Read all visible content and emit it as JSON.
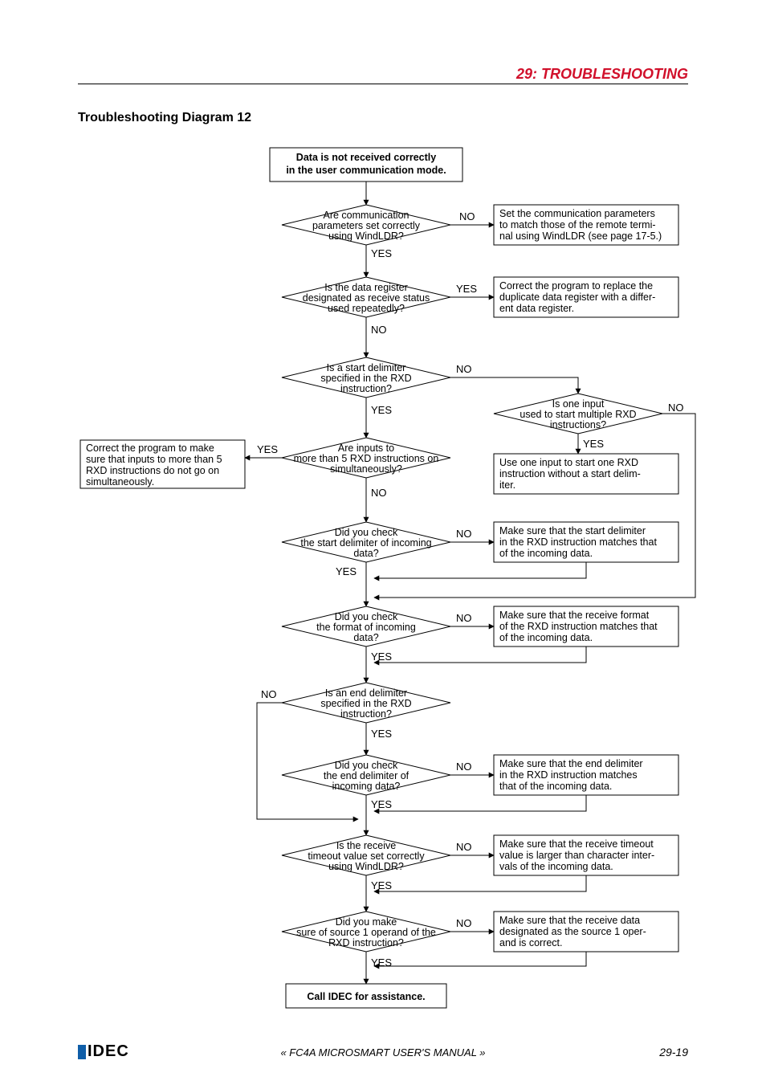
{
  "header": {
    "chapter": "29:",
    "title": "TROUBLESHOOTING"
  },
  "section_title": "Troubleshooting Diagram 12",
  "footer": {
    "manual": "« FC4A MICROSMART USER'S MANUAL »",
    "page": "29-19",
    "brand": "IDEC"
  },
  "labels": {
    "yes": "YES",
    "no": "NO"
  },
  "start": {
    "l1": "Data is not received correctly",
    "l2": "in the user communication mode."
  },
  "q1": {
    "l1": "Are communication",
    "l2": "parameters set correctly",
    "l3": "using WindLDR?"
  },
  "a1": {
    "l1": "Set the communication parameters",
    "l2": "to match those of the remote termi-",
    "l3": "nal using WindLDR (see page 17-5.)"
  },
  "q2": {
    "l1": "Is the data register",
    "l2": "designated as receive status",
    "l3": "used repeatedly?"
  },
  "a2": {
    "l1": "Correct the program to replace the",
    "l2": "duplicate data register with a differ-",
    "l3": "ent data register."
  },
  "q3": {
    "l1": "Is a start delimiter",
    "l2": "specified in the RXD",
    "l3": "instruction?"
  },
  "q3b": {
    "l1": "Is one input",
    "l2": "used to start multiple RXD",
    "l3": "instructions?"
  },
  "a3b": {
    "l1": "Use one input to start one RXD",
    "l2": "instruction without a start delim-",
    "l3": "iter."
  },
  "q4": {
    "l1": "Are inputs to",
    "l2": "more than 5 RXD instructions on",
    "l3": "simultaneously?"
  },
  "a4": {
    "l1": "Correct the program to make",
    "l2": "sure that inputs to more than 5",
    "l3": "RXD instructions do not go on",
    "l4": "simultaneously."
  },
  "q5": {
    "l1": "Did you check",
    "l2": "the start delimiter of incoming",
    "l3": "data?"
  },
  "a5": {
    "l1": "Make sure that the start delimiter",
    "l2": "in the RXD instruction matches that",
    "l3": "of the incoming data."
  },
  "q6": {
    "l1": "Did you check",
    "l2": "the format of incoming",
    "l3": "data?"
  },
  "a6": {
    "l1": "Make sure that the receive format",
    "l2": "of the RXD instruction matches that",
    "l3": "of the incoming data."
  },
  "q7": {
    "l1": "Is an end delimiter",
    "l2": "specified in the RXD",
    "l3": "instruction?"
  },
  "q8": {
    "l1": "Did you check",
    "l2": "the end delimiter of",
    "l3": "incoming data?"
  },
  "a8": {
    "l1": "Make sure that the end delimiter",
    "l2": "in the RXD instruction matches",
    "l3": "that of the incoming data."
  },
  "q9": {
    "l1": "Is the receive",
    "l2": "timeout value set correctly",
    "l3": "using WindLDR?"
  },
  "a9": {
    "l1": "Make sure that the receive timeout",
    "l2": "value is larger than character inter-",
    "l3": "vals of the incoming data."
  },
  "q10": {
    "l1": "Did you make",
    "l2": "sure of source 1 operand of the",
    "l3": "RXD instruction?"
  },
  "a10": {
    "l1": "Make sure that the receive data",
    "l2": "designated as the source 1 oper-",
    "l3": "and is correct."
  },
  "end": {
    "l1": "Call IDEC for assistance."
  },
  "chart_data": {
    "type": "flowchart",
    "title": "Troubleshooting Diagram 12",
    "nodes": [
      {
        "id": "start",
        "type": "terminator",
        "text": "Data is not received correctly in the user communication mode."
      },
      {
        "id": "q1",
        "type": "decision",
        "text": "Are communication parameters set correctly using WindLDR?"
      },
      {
        "id": "a1",
        "type": "process",
        "text": "Set the communication parameters to match those of the remote terminal using WindLDR (see page 17-5.)"
      },
      {
        "id": "q2",
        "type": "decision",
        "text": "Is the data register designated as receive status used repeatedly?"
      },
      {
        "id": "a2",
        "type": "process",
        "text": "Correct the program to replace the duplicate data register with a different data register."
      },
      {
        "id": "q3",
        "type": "decision",
        "text": "Is a start delimiter specified in the RXD instruction?"
      },
      {
        "id": "q3b",
        "type": "decision",
        "text": "Is one input used to start multiple RXD instructions?"
      },
      {
        "id": "a3b",
        "type": "process",
        "text": "Use one input to start one RXD instruction without a start delimiter."
      },
      {
        "id": "q4",
        "type": "decision",
        "text": "Are inputs to more than 5 RXD instructions on simultaneously?"
      },
      {
        "id": "a4",
        "type": "process",
        "text": "Correct the program to make sure that inputs to more than 5 RXD instructions do not go on simultaneously."
      },
      {
        "id": "q5",
        "type": "decision",
        "text": "Did you check the start delimiter of incoming data?"
      },
      {
        "id": "a5",
        "type": "process",
        "text": "Make sure that the start delimiter in the RXD instruction matches that of the incoming data."
      },
      {
        "id": "q6",
        "type": "decision",
        "text": "Did you check the format of incoming data?"
      },
      {
        "id": "a6",
        "type": "process",
        "text": "Make sure that the receive format of the RXD instruction matches that of the incoming data."
      },
      {
        "id": "q7",
        "type": "decision",
        "text": "Is an end delimiter specified in the RXD instruction?"
      },
      {
        "id": "q8",
        "type": "decision",
        "text": "Did you check the end delimiter of incoming data?"
      },
      {
        "id": "a8",
        "type": "process",
        "text": "Make sure that the end delimiter in the RXD instruction matches that of the incoming data."
      },
      {
        "id": "q9",
        "type": "decision",
        "text": "Is the receive timeout value set correctly using WindLDR?"
      },
      {
        "id": "a9",
        "type": "process",
        "text": "Make sure that the receive timeout value is larger than character intervals of the incoming data."
      },
      {
        "id": "q10",
        "type": "decision",
        "text": "Did you make sure of source 1 operand of the RXD instruction?"
      },
      {
        "id": "a10",
        "type": "process",
        "text": "Make sure that the receive data designated as the source 1 operand is correct."
      },
      {
        "id": "end",
        "type": "terminator",
        "text": "Call IDEC for assistance."
      }
    ],
    "edges": [
      {
        "from": "start",
        "to": "q1"
      },
      {
        "from": "q1",
        "to": "a1",
        "label": "NO"
      },
      {
        "from": "q1",
        "to": "q2",
        "label": "YES"
      },
      {
        "from": "q2",
        "to": "a2",
        "label": "YES"
      },
      {
        "from": "q2",
        "to": "q3",
        "label": "NO"
      },
      {
        "from": "q3",
        "to": "q3b",
        "label": "NO"
      },
      {
        "from": "q3",
        "to": "q4",
        "label": "YES"
      },
      {
        "from": "q3b",
        "to": "a3b",
        "label": "YES"
      },
      {
        "from": "q3b",
        "to": "q6",
        "label": "NO",
        "note": "rejoins main flow before q6"
      },
      {
        "from": "q4",
        "to": "a4",
        "label": "YES"
      },
      {
        "from": "q4",
        "to": "q5",
        "label": "NO"
      },
      {
        "from": "q5",
        "to": "a5",
        "label": "NO"
      },
      {
        "from": "a5",
        "to": "q5",
        "type": "feedback"
      },
      {
        "from": "q5",
        "to": "q6",
        "label": "YES"
      },
      {
        "from": "q6",
        "to": "a6",
        "label": "NO"
      },
      {
        "from": "a6",
        "to": "q6",
        "type": "feedback"
      },
      {
        "from": "q6",
        "to": "q7",
        "label": "YES"
      },
      {
        "from": "q7",
        "to": "q9",
        "label": "NO",
        "note": "skips end-delimiter check"
      },
      {
        "from": "q7",
        "to": "q8",
        "label": "YES"
      },
      {
        "from": "q8",
        "to": "a8",
        "label": "NO"
      },
      {
        "from": "a8",
        "to": "q8",
        "type": "feedback"
      },
      {
        "from": "q8",
        "to": "q9",
        "label": "YES"
      },
      {
        "from": "q9",
        "to": "a9",
        "label": "NO"
      },
      {
        "from": "a9",
        "to": "q9",
        "type": "feedback"
      },
      {
        "from": "q9",
        "to": "q10",
        "label": "YES"
      },
      {
        "from": "q10",
        "to": "a10",
        "label": "NO"
      },
      {
        "from": "a10",
        "to": "q10",
        "type": "feedback"
      },
      {
        "from": "q10",
        "to": "end",
        "label": "YES"
      }
    ]
  }
}
